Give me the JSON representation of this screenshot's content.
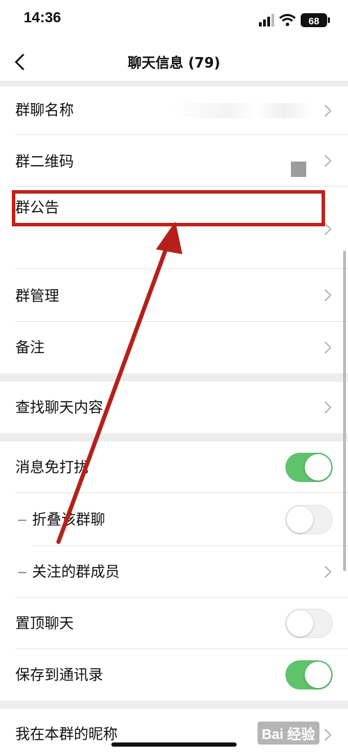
{
  "status_bar": {
    "time": "14:36",
    "battery": "68"
  },
  "nav": {
    "title": "聊天信息 (79)"
  },
  "section1": {
    "group_name": "群聊名称",
    "group_qr": "群二维码",
    "announcement": "群公告",
    "manage": "群管理",
    "remark": "备注"
  },
  "section2": {
    "search": "查找聊天内容"
  },
  "section3": {
    "mute": "消息免打扰",
    "mute_on": true,
    "fold": "折叠该群聊",
    "fold_on": false,
    "watched_members": "关注的群成员",
    "pin": "置顶聊天",
    "pin_on": false,
    "save_contacts": "保存到通讯录",
    "save_on": true
  },
  "section4": {
    "nickname": "我在本群的昵称"
  },
  "watermark": "Bai 经验",
  "colors": {
    "toggle_on": "#5ec36b",
    "highlight": "#c0211b"
  }
}
